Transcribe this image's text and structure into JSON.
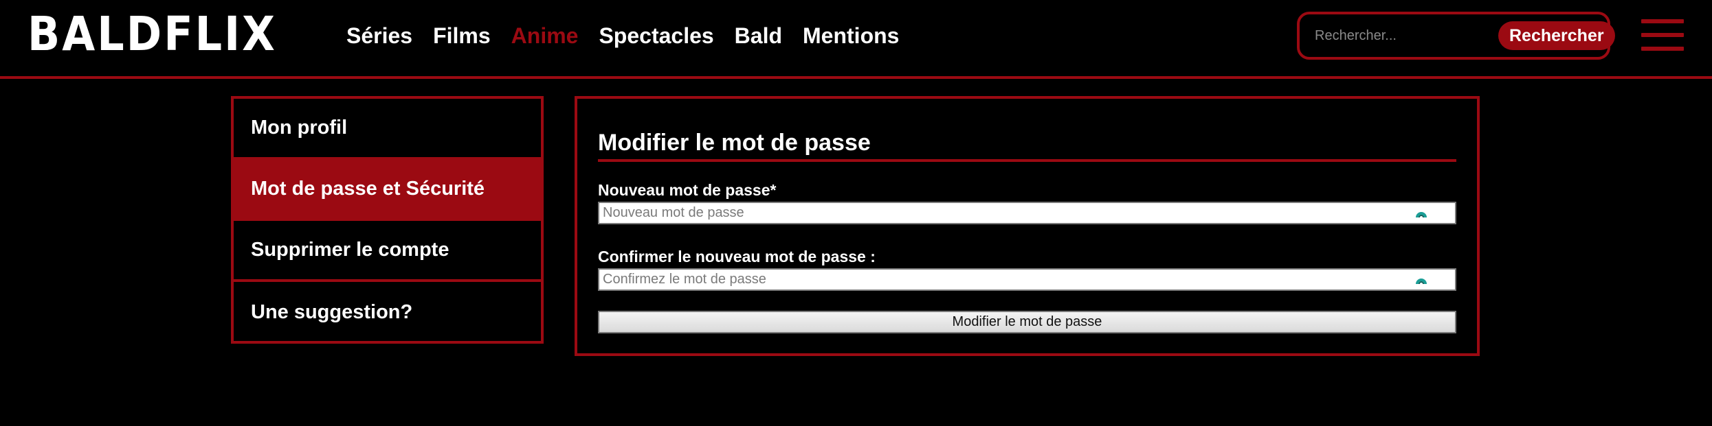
{
  "header": {
    "logo": "BALDFLIX",
    "nav": [
      {
        "label": "Séries",
        "active": false
      },
      {
        "label": "Films",
        "active": false
      },
      {
        "label": "Anime",
        "active": true
      },
      {
        "label": "Spectacles",
        "active": false
      },
      {
        "label": "Bald",
        "active": false
      },
      {
        "label": "Mentions",
        "active": false
      }
    ],
    "search": {
      "placeholder": "Rechercher...",
      "button_label": "Rechercher"
    },
    "menu_icon": "hamburger-menu-icon"
  },
  "sidebar": {
    "items": [
      {
        "label": "Mon profil",
        "active": false
      },
      {
        "label": "Mot de passe et Sécurité",
        "active": true
      },
      {
        "label": "Supprimer le compte",
        "active": false
      },
      {
        "label": "Une suggestion?",
        "active": false
      }
    ]
  },
  "main": {
    "title": "Modifier le mot de passe",
    "fields": [
      {
        "label": "Nouveau mot de passe*",
        "placeholder": "Nouveau mot de passe",
        "value": "",
        "icon": "password-manager-icon"
      },
      {
        "label": "Confirmer le nouveau mot de passe :",
        "placeholder": "Confirmez le mot de passe",
        "value": "",
        "icon": "password-manager-icon"
      }
    ],
    "submit_label": "Modifier le mot de passe"
  },
  "colors": {
    "accent": "#9b0a12",
    "background": "#000000",
    "text": "#ffffff"
  }
}
